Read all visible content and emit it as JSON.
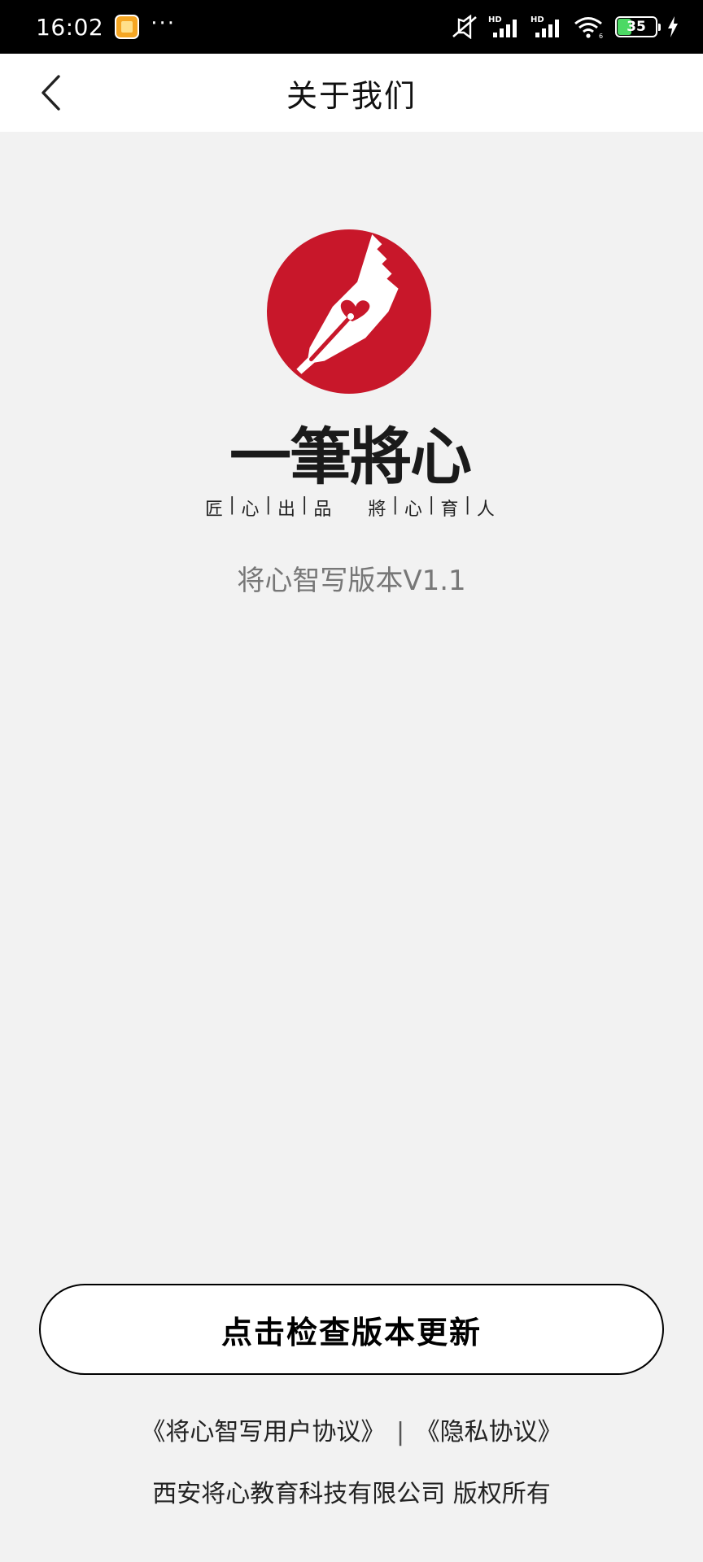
{
  "status_bar": {
    "time": "16:02",
    "more": "···",
    "battery_level": "35",
    "icons": [
      "app-notification-icon",
      "mute-icon",
      "signal-hd-icon",
      "signal-hd-icon",
      "wifi-icon",
      "battery-icon",
      "charging-icon"
    ]
  },
  "nav": {
    "title": "关于我们",
    "back_icon": "chevron-left-icon"
  },
  "logo": {
    "brand": "一筆將心",
    "slogan": [
      "匠",
      "心",
      "出",
      "品",
      "將",
      "心",
      "育",
      "人"
    ],
    "colors": {
      "circle": "#c8172a",
      "nib": "#ffffff"
    }
  },
  "version_text": "将心智写版本V1.1",
  "update_button": "点击检查版本更新",
  "agreements": {
    "user_agreement": "《将心智写用户协议》",
    "separator": "|",
    "privacy": "《隐私协议》"
  },
  "copyright": "西安将心教育科技有限公司 版权所有",
  "colors": {
    "background": "#f2f2f2",
    "nav_background": "#ffffff",
    "version_text": "#777777"
  }
}
